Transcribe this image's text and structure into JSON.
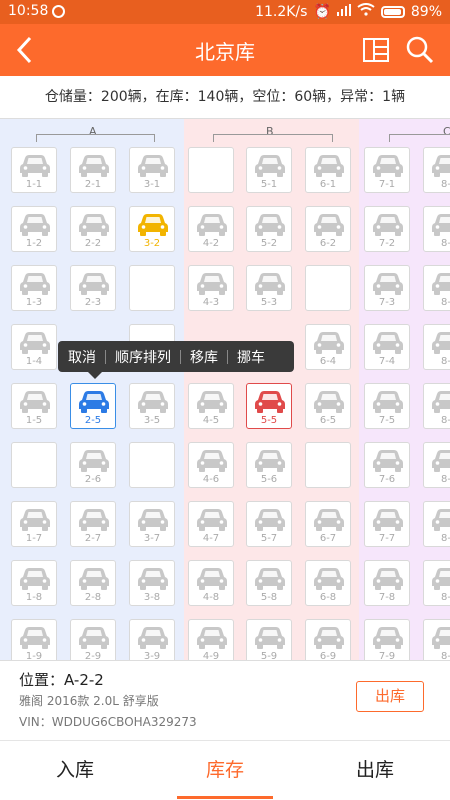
{
  "statusbar": {
    "time": "10:58",
    "speed": "11.2K/s",
    "battery": "89%"
  },
  "navbar": {
    "title": "北京库"
  },
  "summary": {
    "text": "仓储量：200辆，在库：140辆，空位：60辆，异常：1辆"
  },
  "zones": [
    {
      "label": "A"
    },
    {
      "label": "B"
    },
    {
      "label": "C"
    }
  ],
  "slots": {
    "1-1": "1-1",
    "2-1": "2-1",
    "3-1": "3-1",
    "5-1": "5-1",
    "6-1": "6-1",
    "7-1": "7-1",
    "8-1": "8-",
    "1-2": "1-2",
    "2-2": "2-2",
    "3-2": "3-2",
    "4-2": "4-2",
    "5-2": "5-2",
    "6-2": "6-2",
    "7-2": "7-2",
    "8-2": "8-",
    "1-3": "1-3",
    "2-3": "2-3",
    "4-3": "4-3",
    "5-3": "5-3",
    "7-3": "7-3",
    "8-3": "8-",
    "1-4": "1-4",
    "6-4": "6-4",
    "7-4": "7-4",
    "8-4": "8-",
    "1-5": "1-5",
    "2-5": "2-5",
    "3-5": "3-5",
    "4-5": "4-5",
    "5-5": "5-5",
    "6-5": "6-5",
    "7-5": "7-5",
    "8-5": "8-",
    "2-6": "2-6",
    "4-6": "4-6",
    "5-6": "5-6",
    "7-6": "7-6",
    "8-6": "8-",
    "1-7": "1-7",
    "2-7": "2-7",
    "3-7": "3-7",
    "4-7": "4-7",
    "5-7": "5-7",
    "6-7": "6-7",
    "7-7": "7-7",
    "8-7": "8-",
    "1-8": "1-8",
    "2-8": "2-8",
    "3-8": "3-8",
    "4-8": "4-8",
    "5-8": "5-8",
    "6-8": "6-8",
    "7-8": "7-8",
    "8-8": "8-",
    "1-9": "1-9",
    "2-9": "2-9",
    "3-9": "3-9",
    "4-9": "4-9",
    "5-9": "5-9",
    "6-9": "6-9",
    "7-9": "7-9",
    "8-9": "8-"
  },
  "colors": {
    "accent": "#fd6a2c",
    "yellow": "#f2b400",
    "blue": "#2c7be5",
    "red": "#e04a4a",
    "grey": "#c8c8c8"
  },
  "popup": {
    "cancel": "取消",
    "sort": "顺序排列",
    "move": "移库",
    "shift": "挪车"
  },
  "info": {
    "position": "位置：A-2-2",
    "model": "雅阁 2016款 2.0L 舒享版",
    "vin": "VIN：WDDUG6CBOHA329273",
    "out_button": "出库"
  },
  "tabs": {
    "in": "入库",
    "stock": "库存",
    "out": "出库"
  }
}
